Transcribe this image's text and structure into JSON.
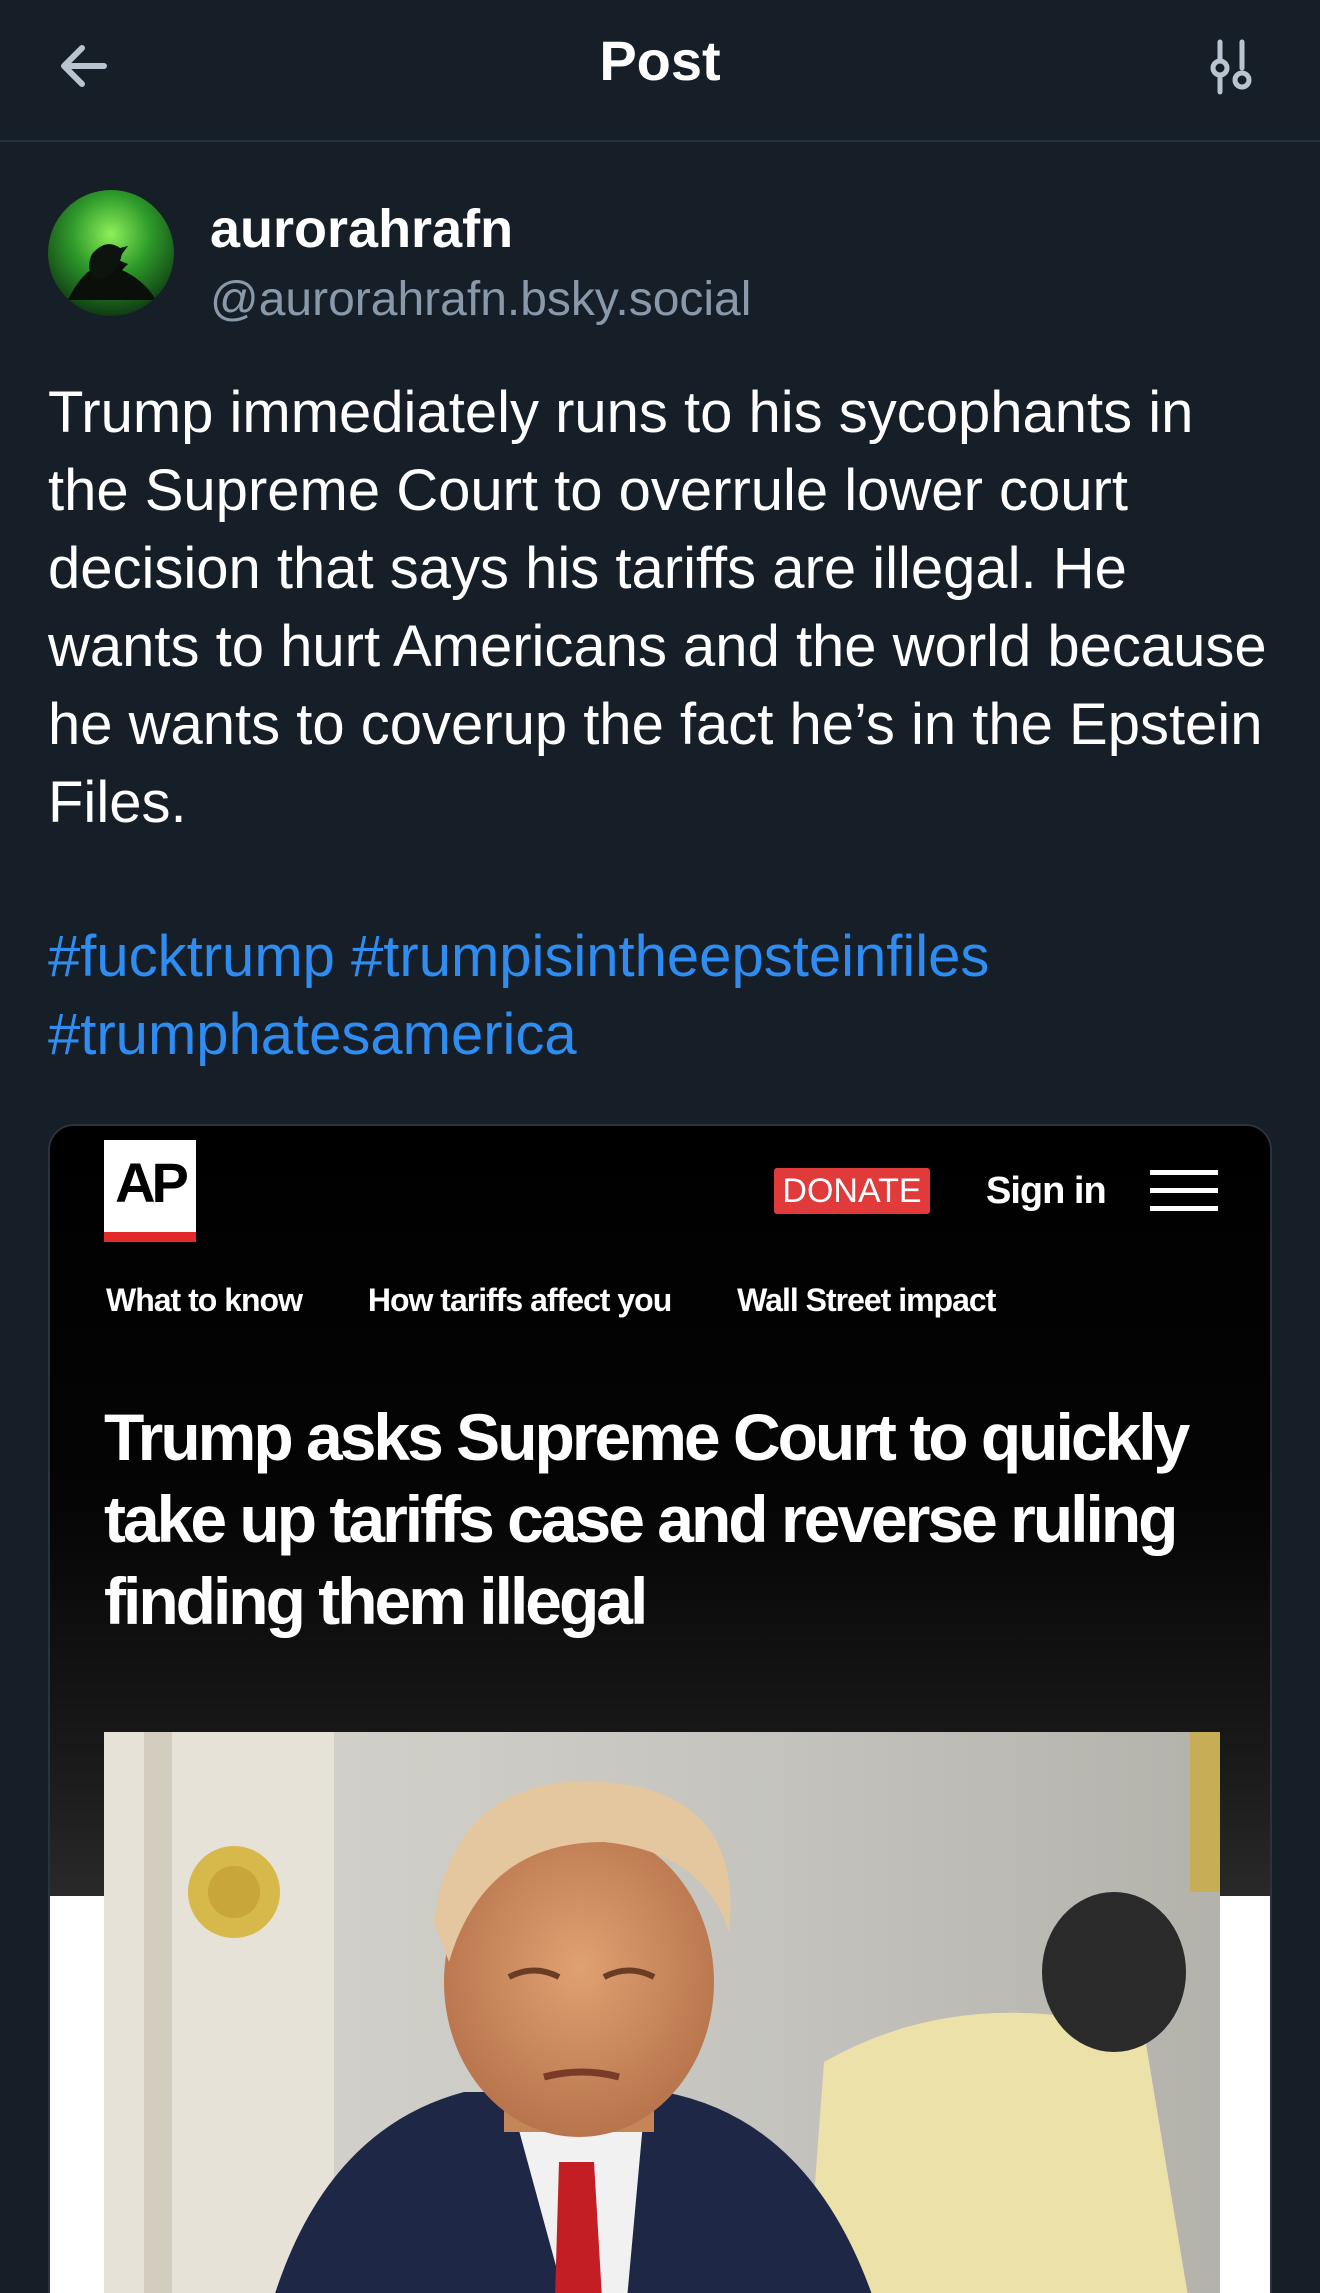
{
  "header": {
    "title": "Post",
    "back_icon": "arrow-left-icon",
    "settings_icon": "sliders-icon"
  },
  "author": {
    "display_name": "aurorahrafn",
    "handle": "@aurorahrafn.bsky.social",
    "avatar_icon": "raven-aurora-avatar"
  },
  "post": {
    "text": "Trump immediately runs to his sycophants in the Supreme Court to overrule lower court decision that says his tariffs are illegal. He wants to hurt Americans and the world because he wants to coverup the fact he’s in the Epstein Files.",
    "hashtags": [
      "#fucktrump",
      "#trumpisintheepsteinfiles",
      "#trumphatesamerica"
    ]
  },
  "embed": {
    "logo": "AP",
    "donate": "DONATE",
    "sign_in": "Sign in",
    "nav": [
      "What to know",
      "How tariffs affect you",
      "Wall Street impact"
    ],
    "headline": "Trump asks Supreme Court to quickly take up tariffs case and reverse ruling finding them illegal"
  },
  "colors": {
    "background": "#161e27",
    "link": "#2f8cf0",
    "muted": "#8a99aa",
    "donate": "#e03a3a"
  }
}
